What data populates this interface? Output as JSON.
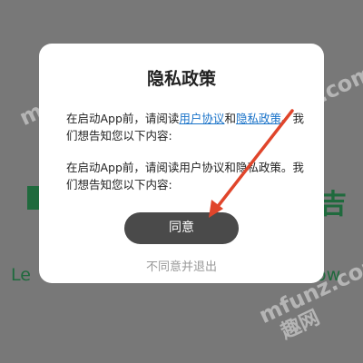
{
  "background": {
    "tagline_left": "Le",
    "tagline_right": "ow",
    "slogan_right": "吉",
    "watermarks": [
      "mfunz.com",
      "mfunz.com",
      "mfunz.com",
      "趣网"
    ]
  },
  "dialog": {
    "title": "隐私政策",
    "para1_prefix": "在启动App前，请阅读",
    "user_agreement_link": "用户协议",
    "and_text": "和",
    "privacy_policy_link": "隐私政策",
    "para1_suffix": "。我们想告知您以下内容:",
    "para2": "在启动App前，请阅读用户协议和隐私政策。我们想告知您以下内容:",
    "agree_label": "同意",
    "decline_label": "不同意并退出"
  },
  "colors": {
    "overlay": "#787878",
    "link": "#1a73c9",
    "agree_button": "#4a4a4a",
    "annotation_arrow": "#e0452b",
    "brand_green": "#1f6a3d"
  },
  "icons": [
    "annotation-arrow-icon"
  ]
}
